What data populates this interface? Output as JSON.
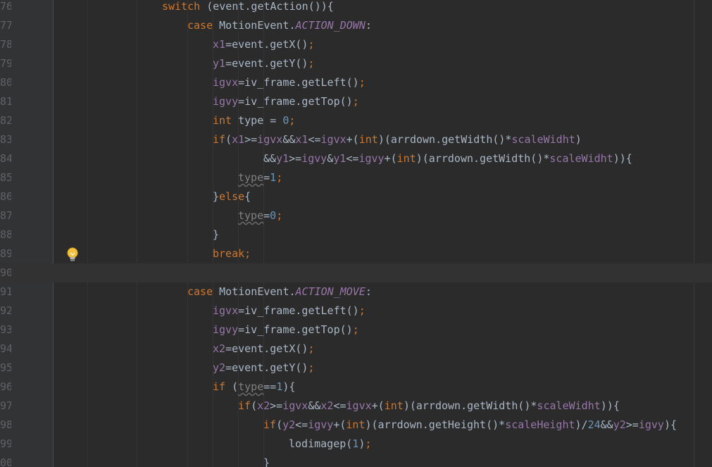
{
  "editor": {
    "gutter": {
      "line_numbers": [
        "76",
        "77",
        "78",
        "79",
        "80",
        "81",
        "82",
        "83",
        "84",
        "85",
        "86",
        "87",
        "88",
        "89",
        "90",
        "91",
        "92",
        "93",
        "94",
        "95",
        "96",
        "97",
        "98",
        "99",
        "00"
      ]
    },
    "intention_icon": "lightbulb-icon",
    "code_lines": [
      {
        "ln": "76",
        "indent": 0,
        "tokens": [
          [
            "kw",
            "switch"
          ],
          [
            "p",
            " (event.getAction()){"
          ]
        ]
      },
      {
        "ln": "77",
        "indent": 1,
        "tokens": [
          [
            "kw",
            "case"
          ],
          [
            "p",
            " MotionEvent."
          ],
          [
            "const",
            "ACTION_DOWN"
          ],
          [
            "p",
            ":"
          ]
        ]
      },
      {
        "ln": "78",
        "indent": 2,
        "tokens": [
          [
            "fld",
            "x1"
          ],
          [
            "p",
            "=event.getX()"
          ],
          [
            "semi",
            ";"
          ]
        ]
      },
      {
        "ln": "79",
        "indent": 2,
        "tokens": [
          [
            "fld",
            "y1"
          ],
          [
            "p",
            "=event.getY()"
          ],
          [
            "semi",
            ";"
          ]
        ]
      },
      {
        "ln": "80",
        "indent": 2,
        "tokens": [
          [
            "fld",
            "igvx"
          ],
          [
            "p",
            "=iv_frame.getLeft()"
          ],
          [
            "semi",
            ";"
          ]
        ]
      },
      {
        "ln": "81",
        "indent": 2,
        "tokens": [
          [
            "fld",
            "igvy"
          ],
          [
            "p",
            "=iv_frame.getTop()"
          ],
          [
            "semi",
            ";"
          ]
        ]
      },
      {
        "ln": "82",
        "indent": 2,
        "tokens": [
          [
            "kw",
            "int"
          ],
          [
            "p",
            " type = "
          ],
          [
            "num",
            "0"
          ],
          [
            "semi",
            ";"
          ]
        ]
      },
      {
        "ln": "83",
        "indent": 2,
        "tokens": [
          [
            "kw",
            "if"
          ],
          [
            "p",
            "("
          ],
          [
            "fld",
            "x1"
          ],
          [
            "p",
            ">="
          ],
          [
            "fld",
            "igvx"
          ],
          [
            "p",
            "&&"
          ],
          [
            "fld",
            "x1"
          ],
          [
            "p",
            "<="
          ],
          [
            "fld",
            "igvx"
          ],
          [
            "p",
            "+("
          ],
          [
            "kw",
            "int"
          ],
          [
            "p",
            ")(arrdown.getWidth()*"
          ],
          [
            "fld",
            "scaleWidht"
          ],
          [
            "p",
            ")"
          ]
        ]
      },
      {
        "ln": "84",
        "indent": 4,
        "tokens": [
          [
            "p",
            "&&"
          ],
          [
            "fld",
            "y1"
          ],
          [
            "p",
            ">="
          ],
          [
            "fld",
            "igvy"
          ],
          [
            "p",
            "&"
          ],
          [
            "fld",
            "y1"
          ],
          [
            "p",
            "<="
          ],
          [
            "fld",
            "igvy"
          ],
          [
            "p",
            "+("
          ],
          [
            "kw",
            "int"
          ],
          [
            "p",
            ")(arrdown.getWidth()*"
          ],
          [
            "fld",
            "scaleWidht"
          ],
          [
            "p",
            ")){"
          ]
        ]
      },
      {
        "ln": "85",
        "indent": 3,
        "tokens": [
          [
            "unused",
            "type"
          ],
          [
            "p",
            "="
          ],
          [
            "num",
            "1"
          ],
          [
            "semi",
            ";"
          ]
        ]
      },
      {
        "ln": "86",
        "indent": 2,
        "tokens": [
          [
            "p",
            "}"
          ],
          [
            "kw",
            "else"
          ],
          [
            "p",
            "{"
          ]
        ]
      },
      {
        "ln": "87",
        "indent": 3,
        "tokens": [
          [
            "unused",
            "type"
          ],
          [
            "p",
            "="
          ],
          [
            "num",
            "0"
          ],
          [
            "semi",
            ";"
          ]
        ]
      },
      {
        "ln": "88",
        "indent": 2,
        "tokens": [
          [
            "p",
            "}"
          ]
        ]
      },
      {
        "ln": "89",
        "indent": 2,
        "tokens": [
          [
            "kw",
            "break"
          ],
          [
            "semi",
            ";"
          ]
        ]
      },
      {
        "ln": "90",
        "indent": 0,
        "tokens": [],
        "current": true
      },
      {
        "ln": "91",
        "indent": 1,
        "tokens": [
          [
            "kw",
            "case"
          ],
          [
            "p",
            " MotionEvent."
          ],
          [
            "const",
            "ACTION_MOVE"
          ],
          [
            "p",
            ":"
          ]
        ]
      },
      {
        "ln": "92",
        "indent": 2,
        "tokens": [
          [
            "fld",
            "igvx"
          ],
          [
            "p",
            "=iv_frame.getLeft()"
          ],
          [
            "semi",
            ";"
          ]
        ]
      },
      {
        "ln": "93",
        "indent": 2,
        "tokens": [
          [
            "fld",
            "igvy"
          ],
          [
            "p",
            "=iv_frame.getTop()"
          ],
          [
            "semi",
            ";"
          ]
        ]
      },
      {
        "ln": "94",
        "indent": 2,
        "tokens": [
          [
            "fld",
            "x2"
          ],
          [
            "p",
            "=event.getX()"
          ],
          [
            "semi",
            ";"
          ]
        ]
      },
      {
        "ln": "95",
        "indent": 2,
        "tokens": [
          [
            "fld",
            "y2"
          ],
          [
            "p",
            "=event.getY()"
          ],
          [
            "semi",
            ";"
          ]
        ]
      },
      {
        "ln": "96",
        "indent": 2,
        "tokens": [
          [
            "kw",
            "if"
          ],
          [
            "p",
            " ("
          ],
          [
            "unused",
            "type"
          ],
          [
            "p",
            "=="
          ],
          [
            "num",
            "1"
          ],
          [
            "p",
            "){"
          ]
        ]
      },
      {
        "ln": "97",
        "indent": 3,
        "tokens": [
          [
            "kw",
            "if"
          ],
          [
            "p",
            "("
          ],
          [
            "fld",
            "x2"
          ],
          [
            "p",
            ">="
          ],
          [
            "fld",
            "igvx"
          ],
          [
            "p",
            "&&"
          ],
          [
            "fld",
            "x2"
          ],
          [
            "p",
            "<="
          ],
          [
            "fld",
            "igvx"
          ],
          [
            "p",
            "+("
          ],
          [
            "kw",
            "int"
          ],
          [
            "p",
            ")(arrdown.getWidth()*"
          ],
          [
            "fld",
            "scaleWidht"
          ],
          [
            "p",
            ")){"
          ]
        ]
      },
      {
        "ln": "98",
        "indent": 4,
        "tokens": [
          [
            "kw",
            "if"
          ],
          [
            "p",
            "("
          ],
          [
            "fld",
            "y2"
          ],
          [
            "p",
            "<="
          ],
          [
            "fld",
            "igvy"
          ],
          [
            "p",
            "+("
          ],
          [
            "kw",
            "int"
          ],
          [
            "p",
            ")(arrdown.getHeight()*"
          ],
          [
            "fld",
            "scaleHeight"
          ],
          [
            "p",
            ")/"
          ],
          [
            "num",
            "24"
          ],
          [
            "p",
            "&&"
          ],
          [
            "fld",
            "y2"
          ],
          [
            "p",
            ">="
          ],
          [
            "fld",
            "igvy"
          ],
          [
            "p",
            "){"
          ]
        ]
      },
      {
        "ln": "99",
        "indent": 5,
        "tokens": [
          [
            "p",
            "lodimagep("
          ],
          [
            "num",
            "1"
          ],
          [
            "p",
            ")"
          ],
          [
            "semi",
            ";"
          ]
        ]
      },
      {
        "ln": "00",
        "indent": 4,
        "tokens": [
          [
            "p",
            "}"
          ]
        ]
      }
    ]
  }
}
